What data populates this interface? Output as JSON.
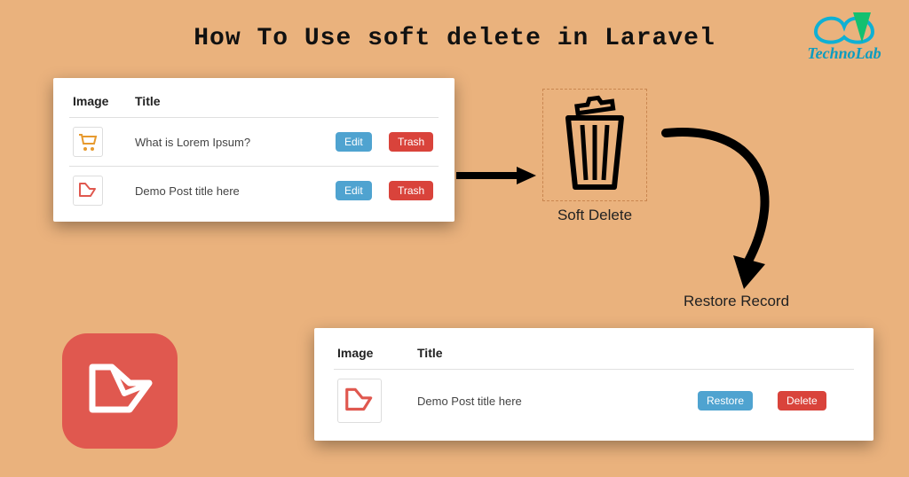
{
  "title": "How To Use soft delete in Laravel",
  "brand": {
    "name": "TechnoLab"
  },
  "table1": {
    "headers": {
      "image": "Image",
      "title": "Title"
    },
    "rows": [
      {
        "icon": "cart",
        "title": "What is Lorem Ipsum?",
        "edit": "Edit",
        "trash": "Trash"
      },
      {
        "icon": "laravel",
        "title": "Demo Post title here",
        "edit": "Edit",
        "trash": "Trash"
      }
    ]
  },
  "soft_delete_label": "Soft Delete",
  "restore_label": "Restore Record",
  "table2": {
    "headers": {
      "image": "Image",
      "title": "Title"
    },
    "rows": [
      {
        "icon": "laravel",
        "title": "Demo Post title here",
        "restore": "Restore",
        "delete": "Delete"
      }
    ]
  }
}
